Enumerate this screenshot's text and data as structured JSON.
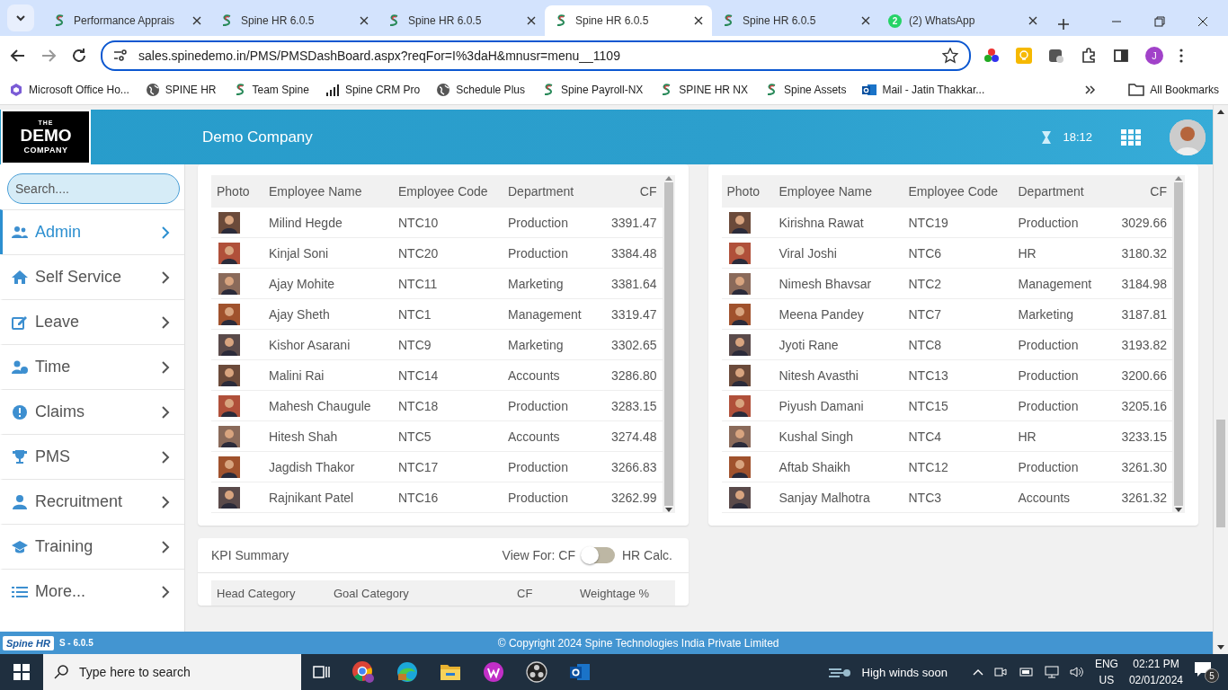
{
  "browser": {
    "tabs": [
      {
        "title": "Performance Apprais",
        "selected": false
      },
      {
        "title": "Spine HR 6.0.5",
        "selected": false
      },
      {
        "title": "Spine HR 6.0.5",
        "selected": false
      },
      {
        "title": "Spine HR 6.0.5",
        "selected": true
      },
      {
        "title": "Spine HR 6.0.5",
        "selected": false
      },
      {
        "title": "(2) WhatsApp",
        "badge": "2",
        "selected": false
      }
    ],
    "address": "sales.spinedemo.in/PMS/PMSDashBoard.aspx?reqFor=I%3daH&mnusr=menu__1109",
    "profile_initial": "J",
    "bookmarks": [
      "Microsoft Office Ho...",
      "SPINE HR",
      "Team Spine",
      "Spine CRM Pro",
      "Schedule Plus",
      "Spine Payroll-NX",
      "SPINE HR NX",
      "Spine Assets",
      "Mail - Jatin Thakkar..."
    ],
    "all_bookmarks": "All Bookmarks"
  },
  "app": {
    "logo": {
      "top": "THE",
      "main": "DEMO",
      "bottom": "COMPANY"
    },
    "company": "Demo Company",
    "timer": "18:12"
  },
  "sidebar": {
    "search": {
      "placeholder": "Search...."
    },
    "items": [
      {
        "label": "Admin",
        "selected": true
      },
      {
        "label": "Self Service",
        "selected": false
      },
      {
        "label": "Leave",
        "selected": false
      },
      {
        "label": "Time",
        "selected": false
      },
      {
        "label": "Claims",
        "selected": false
      },
      {
        "label": "PMS",
        "selected": false
      },
      {
        "label": "Recruitment",
        "selected": false
      },
      {
        "label": "Training",
        "selected": false
      },
      {
        "label": "More...",
        "selected": false
      }
    ]
  },
  "tables": [
    {
      "columns": [
        "Photo",
        "Employee Name",
        "Employee Code",
        "Department",
        "CF"
      ],
      "rows": [
        {
          "name": "Milind Hegde",
          "code": "NTC10",
          "department": "Production",
          "cf": "3391.47"
        },
        {
          "name": "Kinjal Soni",
          "code": "NTC20",
          "department": "Production",
          "cf": "3384.48"
        },
        {
          "name": "Ajay Mohite",
          "code": "NTC11",
          "department": "Marketing",
          "cf": "3381.64"
        },
        {
          "name": "Ajay Sheth",
          "code": "NTC1",
          "department": "Management",
          "cf": "3319.47"
        },
        {
          "name": "Kishor Asarani",
          "code": "NTC9",
          "department": "Marketing",
          "cf": "3302.65"
        },
        {
          "name": "Malini Rai",
          "code": "NTC14",
          "department": "Accounts",
          "cf": "3286.80"
        },
        {
          "name": "Mahesh Chaugule",
          "code": "NTC18",
          "department": "Production",
          "cf": "3283.15"
        },
        {
          "name": "Hitesh Shah",
          "code": "NTC5",
          "department": "Accounts",
          "cf": "3274.48"
        },
        {
          "name": "Jagdish Thakor",
          "code": "NTC17",
          "department": "Production",
          "cf": "3266.83"
        },
        {
          "name": "Rajnikant Patel",
          "code": "NTC16",
          "department": "Production",
          "cf": "3262.99"
        }
      ]
    },
    {
      "columns": [
        "Photo",
        "Employee Name",
        "Employee Code",
        "Department",
        "CF"
      ],
      "rows": [
        {
          "name": "Kirishna Rawat",
          "code": "NTC19",
          "department": "Production",
          "cf": "3029.66"
        },
        {
          "name": "Viral Joshi",
          "code": "NTC6",
          "department": "HR",
          "cf": "3180.32"
        },
        {
          "name": "Nimesh Bhavsar",
          "code": "NTC2",
          "department": "Management",
          "cf": "3184.98"
        },
        {
          "name": "Meena Pandey",
          "code": "NTC7",
          "department": "Marketing",
          "cf": "3187.81"
        },
        {
          "name": "Jyoti Rane",
          "code": "NTC8",
          "department": "Production",
          "cf": "3193.82"
        },
        {
          "name": "Nitesh Avasthi",
          "code": "NTC13",
          "department": "Production",
          "cf": "3200.66"
        },
        {
          "name": "Piyush Damani",
          "code": "NTC15",
          "department": "Production",
          "cf": "3205.16"
        },
        {
          "name": "Kushal Singh",
          "code": "NTC4",
          "department": "HR",
          "cf": "3233.15"
        },
        {
          "name": "Aftab Shaikh",
          "code": "NTC12",
          "department": "Production",
          "cf": "3261.30"
        },
        {
          "name": "Sanjay Malhotra",
          "code": "NTC3",
          "department": "Accounts",
          "cf": "3261.32"
        }
      ]
    }
  ],
  "kpi_summary": {
    "title": "KPI Summary",
    "view_for": "View For: CF",
    "toggle_on": false,
    "alt_label": "HR Calc.",
    "columns": [
      "Head Category",
      "Goal Category",
      "CF",
      "Weightage %"
    ]
  },
  "footer": {
    "brand": "Spine HR",
    "version": "S - 6.0.5",
    "copyright": "© Copyright 2024 Spine Technologies India Private Limited"
  },
  "taskbar": {
    "search": {
      "placeholder": "Type here to search"
    },
    "weather": "High winds soon",
    "lang": "ENG",
    "region": "US",
    "time": "02:21 PM",
    "date": "02/01/2024",
    "notifications": "5"
  }
}
